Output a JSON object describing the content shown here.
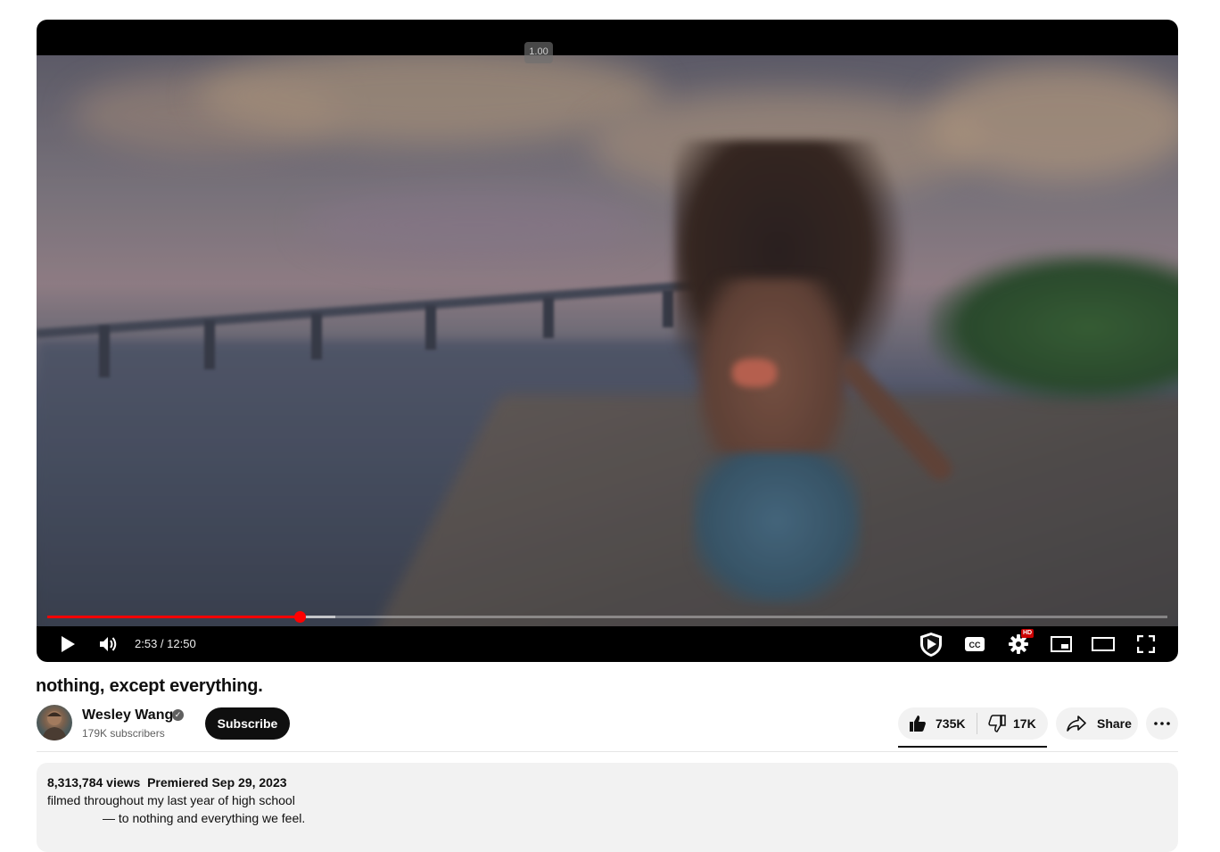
{
  "player": {
    "speed_tooltip": "1.00",
    "time_current": "2:53",
    "time_total": "12:50",
    "time_display": "2:53 / 12:50",
    "progress_fraction": 0.225,
    "buffered_fraction": 0.257,
    "controls": {
      "play": "play-icon",
      "volume": "volume-icon",
      "sponsor": "shield-play-icon",
      "captions": "cc-icon",
      "settings": "gear-icon",
      "settings_badge": "HD",
      "miniplayer": "miniplayer-icon",
      "theater": "theater-mode-icon",
      "fullscreen": "fullscreen-icon"
    },
    "accent_color": "#ff0000"
  },
  "video": {
    "title": "nothing, except everything."
  },
  "channel": {
    "name": "Wesley Wang",
    "subscribers": "179K subscribers",
    "verified_icon": "verified-check-icon",
    "subscribe_label": "Subscribe"
  },
  "actions": {
    "likes": "735K",
    "dislikes": "17K",
    "share_label": "Share",
    "more_icon": "more-horizontal-icon"
  },
  "description": {
    "meta": "8,313,784 views  Premiered Sep 29, 2023",
    "line1": "filmed throughout my last year of high school",
    "line2": "— to nothing and everything we feel."
  }
}
